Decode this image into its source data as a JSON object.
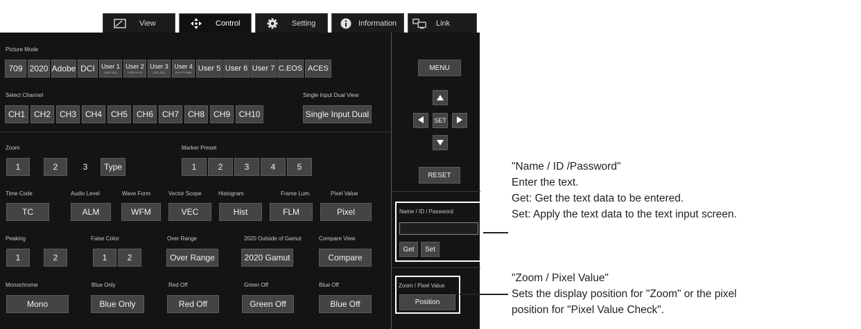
{
  "tabs": [
    {
      "label": "View",
      "icon": "image-icon"
    },
    {
      "label": "Control",
      "icon": "move-arrows-icon"
    },
    {
      "label": "Setting",
      "icon": "gear-icon"
    },
    {
      "label": "Information",
      "icon": "info-icon"
    },
    {
      "label": "Link",
      "icon": "monitor-link-icon"
    }
  ],
  "picture_mode": {
    "label": "Picture Mode",
    "buttons": [
      "709",
      "2020",
      "Adobe",
      "DCI"
    ],
    "users": [
      {
        "label": "User 1",
        "sub": "(2020 PQ)"
      },
      {
        "label": "User 2",
        "sub": "(2020 HLG)"
      },
      {
        "label": "User 3",
        "sub": "(DCI PQ)"
      },
      {
        "label": "User 4",
        "sub": "(DCI P3 D65)"
      }
    ],
    "buttons2": [
      "User 5",
      "User 6",
      "User 7",
      "C.EOS",
      "ACES"
    ]
  },
  "select_channel": {
    "label": "Select Channel",
    "buttons": [
      "CH1",
      "CH2",
      "CH3",
      "CH4",
      "CH5",
      "CH6",
      "CH7",
      "CH8",
      "CH9",
      "CH10"
    ],
    "dual_label": "Single Input Dual View",
    "dual_button": "Single Input Dual"
  },
  "zoom": {
    "label": "Zoom",
    "buttons": [
      "1",
      "2",
      "3",
      "Type"
    ]
  },
  "marker_preset": {
    "label": "Marker Preset",
    "buttons": [
      "1",
      "2",
      "3",
      "4",
      "5"
    ]
  },
  "row_labels_1": [
    "Time Code",
    "Audio Level",
    "Wave Form",
    "Vector Scope",
    "Histogram",
    "Frame Lum.",
    "Pixel Value"
  ],
  "row_buttons_1": [
    "TC",
    "ALM",
    "WFM",
    "VEC",
    "Hist",
    "FLM",
    "Pixel"
  ],
  "peaking": {
    "label": "Peaking",
    "buttons": [
      "1",
      "2"
    ]
  },
  "false_color": {
    "label": "False Color",
    "buttons": [
      "1",
      "2"
    ]
  },
  "over_range": {
    "label": "Over Range",
    "button": "Over Range"
  },
  "gamut": {
    "label": "2020 Outside of Gamut",
    "button": "2020 Gamut"
  },
  "compare": {
    "label": "Compare View",
    "button": "Compare"
  },
  "row_labels_3": [
    "Monochrome",
    "Blue Only",
    "Red Off",
    "Green Off",
    "Blue Off"
  ],
  "row_buttons_3": [
    "Mono",
    "Blue Only",
    "Red Off",
    "Green Off",
    "Blue Off"
  ],
  "right": {
    "menu": "MENU",
    "set": "SET",
    "reset": "RESET",
    "name_label": "Name / ID / Password",
    "name_value": "",
    "get": "Get",
    "set_btn": "Set",
    "zoom_label": "Zoom / Pixel Value",
    "position": "Position"
  },
  "callouts": {
    "name": {
      "title": "\"Name / ID /Password\"",
      "lines": [
        "Enter the text.",
        "Get: Get the text data to be entered.",
        "Set: Apply the text data to the text input screen."
      ]
    },
    "zoom": {
      "title": "\"Zoom / Pixel Value\"",
      "lines": [
        "Sets the display position for \"Zoom\" or the pixel",
        "position for \"Pixel Value Check\"."
      ]
    }
  }
}
